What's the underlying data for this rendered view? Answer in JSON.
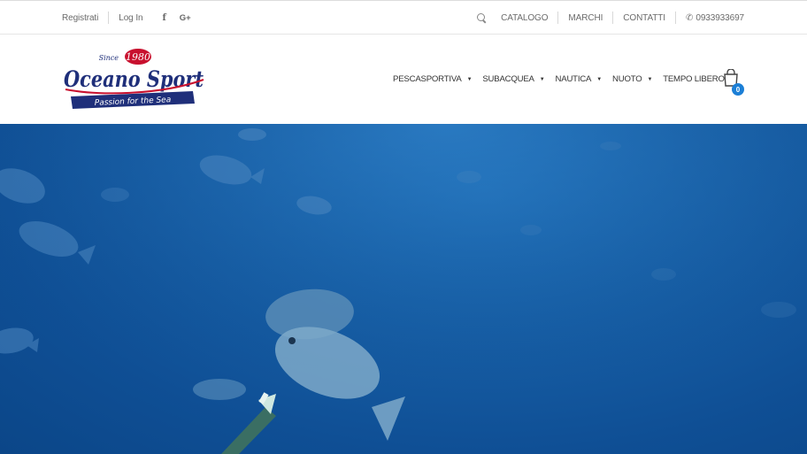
{
  "topbar": {
    "register_label": "Registrati",
    "login_label": "Log In",
    "facebook_icon": "f",
    "googleplus_icon": "G+",
    "catalog_label": "CATALOGO",
    "brands_label": "MARCHI",
    "contacts_label": "CONTATTI",
    "phone": "0933933697"
  },
  "logo": {
    "since": "Since",
    "year": "1980",
    "brand": "Oceano Sport",
    "tagline": "Passion for the Sea"
  },
  "nav": {
    "items": [
      {
        "label": "PESCASPORTIVA"
      },
      {
        "label": "SUBACQUEA"
      },
      {
        "label": "NAUTICA"
      },
      {
        "label": "NUOTO"
      },
      {
        "label": "TEMPO LIBERO"
      }
    ]
  },
  "cart": {
    "count": "0"
  },
  "colors": {
    "accent_blue": "#1c7fd6",
    "logo_navy": "#1f2f7a",
    "logo_red": "#c8102e",
    "ocean": "#175fa6"
  }
}
